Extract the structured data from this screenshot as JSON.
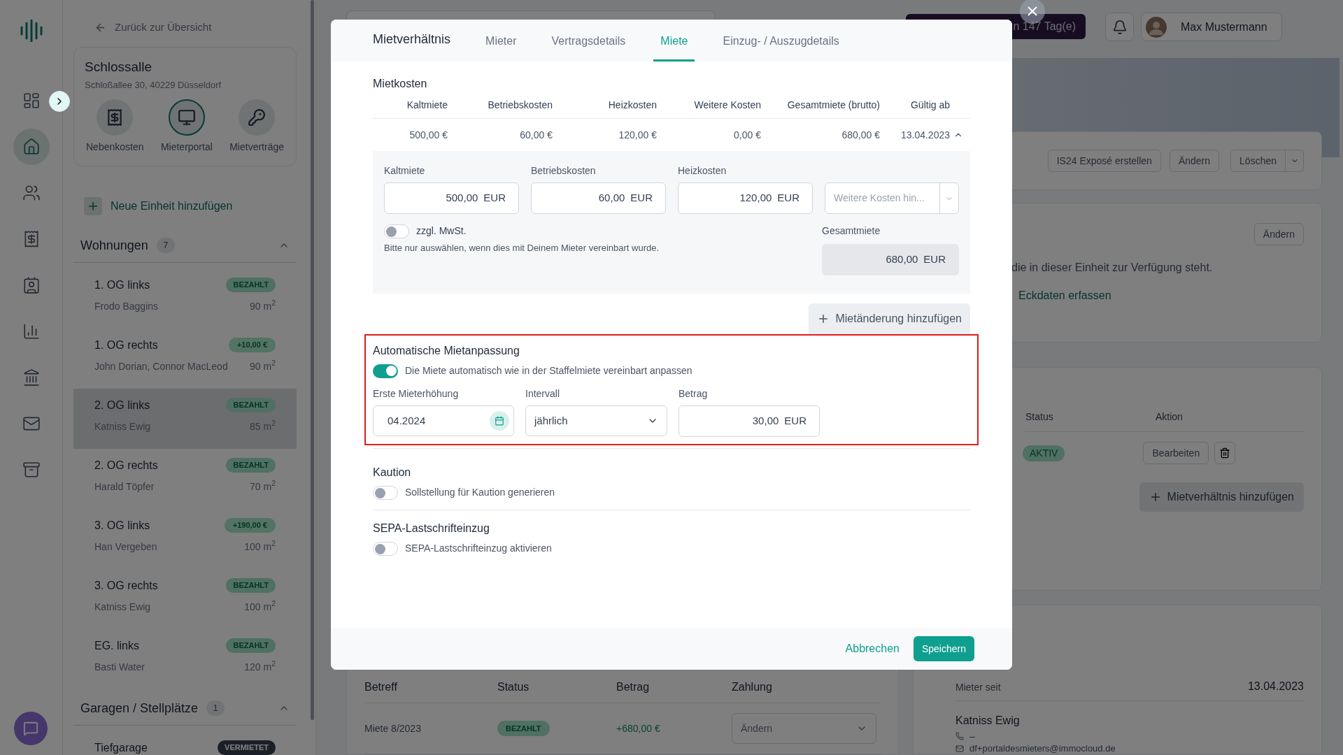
{
  "app_rail": [
    {
      "selected": false
    },
    {
      "selected": true
    },
    {
      "selected": false
    },
    {
      "selected": false
    },
    {
      "selected": false
    },
    {
      "selected": false
    },
    {
      "selected": false
    },
    {
      "selected": false
    },
    {
      "selected": false
    }
  ],
  "sidebar": {
    "back_link": "Zurück zur Übersicht",
    "property": {
      "name": "Schlossalle",
      "address": "Schloßallee 30, 40229 Düsseldorf",
      "shortcuts": [
        {
          "label": "Nebenkosten",
          "selected": false
        },
        {
          "label": "Mieterportal",
          "selected": true
        },
        {
          "label": "Mietverträge",
          "selected": false
        }
      ]
    },
    "add_unit": "Neue Einheit hinzufügen",
    "groups": [
      {
        "title": "Wohnungen",
        "count": "7",
        "units": [
          {
            "name": "1. OG links",
            "tenant": "Frodo Baggins",
            "badge": "BEZAHLT",
            "kind": "paid",
            "area": "90 m$^{2}$",
            "selected": false
          },
          {
            "name": "1. OG rechts",
            "tenant": "John Dorian, Connor MacLeod",
            "badge": "+10,00 €",
            "kind": "credit",
            "area": "90 m$^{2}$",
            "selected": false
          },
          {
            "name": "2. OG links",
            "tenant": "Katniss Ewig",
            "badge": "BEZAHLT",
            "kind": "paid",
            "area": "85 m$^{2}$",
            "selected": true
          },
          {
            "name": "2. OG rechts",
            "tenant": "Harald Töpfer",
            "badge": "BEZAHLT",
            "kind": "paid",
            "area": "70 m$^{2}$",
            "selected": false
          },
          {
            "name": "3. OG links",
            "tenant": "Han Vergeben",
            "badge": "+190,00 €",
            "kind": "credit",
            "area": "100 m$^{2}$",
            "selected": false
          },
          {
            "name": "3. OG rechts",
            "tenant": "Katniss Ewig",
            "badge": "BEZAHLT",
            "kind": "paid",
            "area": "100 m$^{2}$",
            "selected": false
          },
          {
            "name": "EG. links",
            "tenant": "Basti Water",
            "badge": "BEZAHLT",
            "kind": "paid",
            "area": "120 m$^{2}$",
            "selected": false
          }
        ]
      },
      {
        "title": "Garagen / Stellplätze",
        "count": "1",
        "units": [
          {
            "name": "Tiefgarage",
            "badge": "VERMIETET",
            "kind": "rented",
            "selected": false
          }
        ]
      }
    ]
  },
  "header": {
    "trial_banner": "n 147 Tag(e)",
    "user": "Max Mustermann"
  },
  "unit_actions": [
    "IS24 Exposé erstellen",
    "Ändern",
    "Löschen"
  ],
  "details_card": {
    "button": "Ändern",
    "text": "die in dieser Einheit zur Verfügung steht.",
    "link": "Eckdaten erfassen"
  },
  "tenancies": {
    "columns": [
      "Status",
      "Aktion"
    ],
    "rows": [
      {
        "status": "AKTIV",
        "action": "Bearbeiten"
      }
    ],
    "add_button": "Mietverhältnis hinzufügen"
  },
  "tenant_card": {
    "since_label": "Mieter seit",
    "since": "13.04.2023",
    "name": "Katniss Ewig",
    "phone": "–",
    "email": "df+portaldesmieters@immocloud.de"
  },
  "payments": {
    "columns": [
      "Betreff",
      "Status",
      "Betrag",
      "Zahlung"
    ],
    "rows": [
      {
        "subject": "Miete 8/2023",
        "status": "BEZAHLT",
        "amount": "+680,00 €",
        "action": "Ändern"
      }
    ]
  },
  "modal": {
    "title": "Mietverhältnis",
    "tabs": [
      {
        "label": "Mieter",
        "selected": false
      },
      {
        "label": "Vertragsdetails",
        "selected": false
      },
      {
        "label": "Miete",
        "selected": true
      },
      {
        "label": "Einzug- / Auszugdetails",
        "selected": false
      }
    ],
    "rent": {
      "title": "Mietkosten",
      "columns": [
        "Kaltmiete",
        "Betriebskosten",
        "Heizkosten",
        "Weitere Kosten",
        "Gesamtmiete (brutto)",
        "Gültig ab"
      ],
      "rows": [
        {
          "cells": [
            "500,00 €",
            "60,00 €",
            "120,00 €",
            "0,00 €",
            "680,00 €",
            "13.04.2023"
          ],
          "expanded": true
        }
      ],
      "fields": [
        {
          "label": "Kaltmiete",
          "value": "500,00",
          "unit": "EUR"
        },
        {
          "label": "Betriebskosten",
          "value": "60,00",
          "unit": "EUR"
        },
        {
          "label": "Heizkosten",
          "value": "120,00",
          "unit": "EUR"
        }
      ],
      "more_costs": {
        "placeholder": "Weitere Kosten hin..."
      },
      "vat": {
        "label": "zzgl. MwSt.",
        "on": false,
        "hint": "Bitte nur auswählen, wenn dies mit Deinem Mieter vereinbart wurde."
      },
      "total": {
        "label": "Gesamtmiete",
        "value": "680,00",
        "unit": "EUR"
      },
      "add_button": "Mietänderung hinzufügen"
    },
    "auto_adjust": {
      "title": "Automatische Mietanpassung",
      "highlighted": true,
      "toggle": {
        "label": "Die Miete automatisch wie in der Staffelmiete vereinbart anpassen",
        "on": true
      },
      "first_increase": {
        "label": "Erste Mieterhöhung",
        "value": "04.2024"
      },
      "interval": {
        "label": "Intervall",
        "value": "jährlich"
      },
      "amount": {
        "label": "Betrag",
        "value": "30,00",
        "unit": "EUR"
      }
    },
    "deposit": {
      "title": "Kaution",
      "toggle": {
        "label": "Sollstellung für Kaution generieren",
        "on": false
      }
    },
    "sepa": {
      "title": "SEPA-Lastschrifteinzug",
      "toggle": {
        "label": "SEPA-Lastschrifteinzug aktivieren",
        "on": false
      }
    },
    "cancel": "Abbrechen",
    "save": "Speichern"
  }
}
